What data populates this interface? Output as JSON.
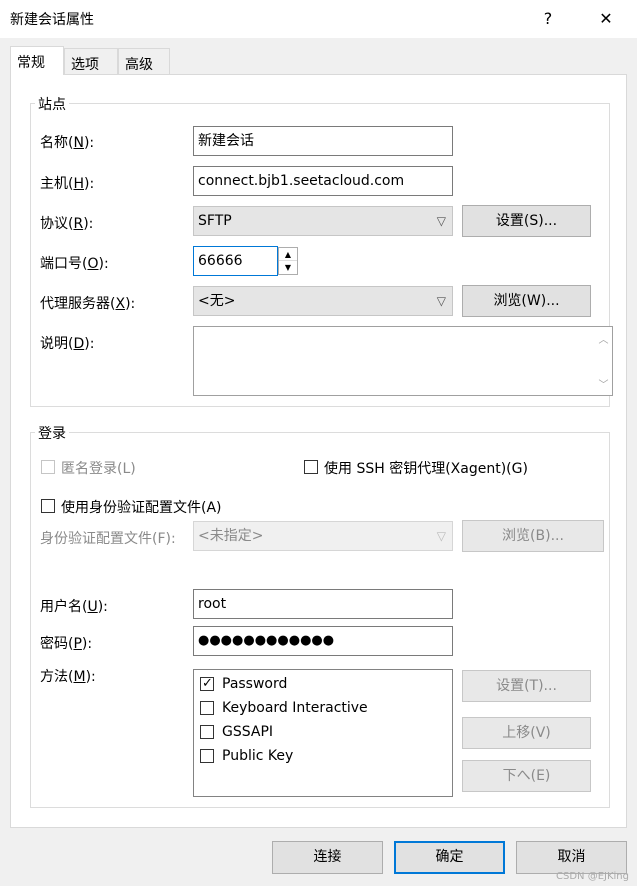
{
  "window": {
    "title": "新建会话属性",
    "help_label": "?",
    "close_label": "✕"
  },
  "tabs": [
    {
      "label": "常规",
      "active": true
    },
    {
      "label": "选项",
      "active": false
    },
    {
      "label": "高级",
      "active": false
    }
  ],
  "site": {
    "group_title": "站点",
    "name_label": "名称(",
    "name_key": "N",
    "name_end": "):",
    "name_value": "新建会话",
    "host_label": "主机(",
    "host_key": "H",
    "host_end": "):",
    "host_value": "connect.bjb1.seetacloud.com",
    "protocol_label": "协议(",
    "protocol_key": "R",
    "protocol_end": "):",
    "protocol_value": "SFTP",
    "settings_button": "设置(S)...",
    "port_label": "端口号(",
    "port_key": "O",
    "port_end": "):",
    "port_value": "66666",
    "proxy_label": "代理服务器(",
    "proxy_key": "X",
    "proxy_end": "):",
    "proxy_value": "<无>",
    "browse_button": "浏览(W)...",
    "desc_label": "说明(",
    "desc_key": "D",
    "desc_end": "):",
    "desc_value": ""
  },
  "login": {
    "group_title": "登录",
    "anonymous_label": "匿名登录(L)",
    "anonymous_checked": false,
    "ssh_agent_label": "使用 SSH 密钥代理(Xagent)(G)",
    "ssh_agent_checked": false,
    "use_profile_label": "使用身份验证配置文件(A)",
    "use_profile_checked": false,
    "profile_label": "身份验证配置文件(F):",
    "profile_value": "<未指定>",
    "profile_browse_button": "浏览(B)...",
    "username_label": "用户名(",
    "username_key": "U",
    "username_end": "):",
    "username_value": "root",
    "password_label": "密码(",
    "password_key": "P",
    "password_end": "):",
    "password_value": "●●●●●●●●●●●●",
    "method_label": "方法(",
    "method_key": "M",
    "method_end": "):",
    "methods": [
      {
        "label": "Password",
        "checked": true
      },
      {
        "label": "Keyboard Interactive",
        "checked": false
      },
      {
        "label": "GSSAPI",
        "checked": false
      },
      {
        "label": "Public Key",
        "checked": false
      }
    ],
    "method_settings_button": "设置(T)...",
    "move_up_button": "上移(V)",
    "move_down_button": "下へ(E)"
  },
  "footer": {
    "connect_button": "连接",
    "ok_button": "确定",
    "cancel_button": "取消"
  },
  "watermark": "CSDN @EJKing"
}
